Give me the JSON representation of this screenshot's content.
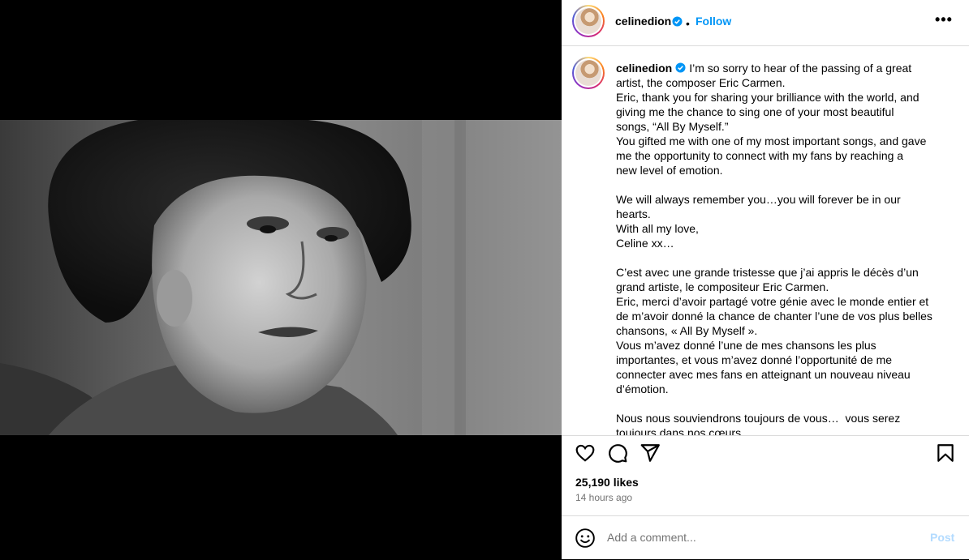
{
  "post": {
    "username": "celinedion",
    "separator": "•",
    "follow_label": "Follow",
    "more_label": "•••",
    "caption": "I’m so sorry to hear of the passing of a great\nartist, the composer Eric Carmen.\nEric, thank you for sharing your brilliance with the world, and\ngiving me the chance to sing one of your most beautiful\nsongs, “All By Myself.”\nYou gifted me with one of my most important songs, and gave\nme the opportunity to connect with my fans by reaching a\nnew level of emotion.\n\nWe will always remember you…you will forever be in our\nhearts.\nWith all my love,\nCeline xx…\n\nC’est avec une grande tristesse que j’ai appris le décès d’un\ngrand artiste, le compositeur Eric Carmen.\nEric, merci d’avoir partagé votre génie avec le monde entier et\nde m’avoir donné la chance de chanter l’une de vos plus belles\nchansons, « All By Myself ».\nVous m’avez donné l’une de mes chansons les plus\nimportantes, et vous m’avez donné l’opportunité de me\nconnecter avec mes fans en atteignant un nouveau niveau\nd’émotion.\n\nNous nous souviendrons toujours de vous…  vous serez\ntoujours dans nos cœurs.",
    "likes": "25,190 likes",
    "timestamp": "14 hours ago"
  },
  "comment": {
    "placeholder": "Add a comment...",
    "post_label": "Post"
  },
  "icons": {
    "verified": "verified-badge-icon",
    "like": "heart-icon",
    "comment": "comment-icon",
    "share": "share-icon",
    "save": "bookmark-icon",
    "emoji": "emoji-icon"
  },
  "colors": {
    "accent": "#0095f6",
    "post_disabled": "#b3dbff",
    "muted": "#737373",
    "border": "#dbdbdb"
  }
}
